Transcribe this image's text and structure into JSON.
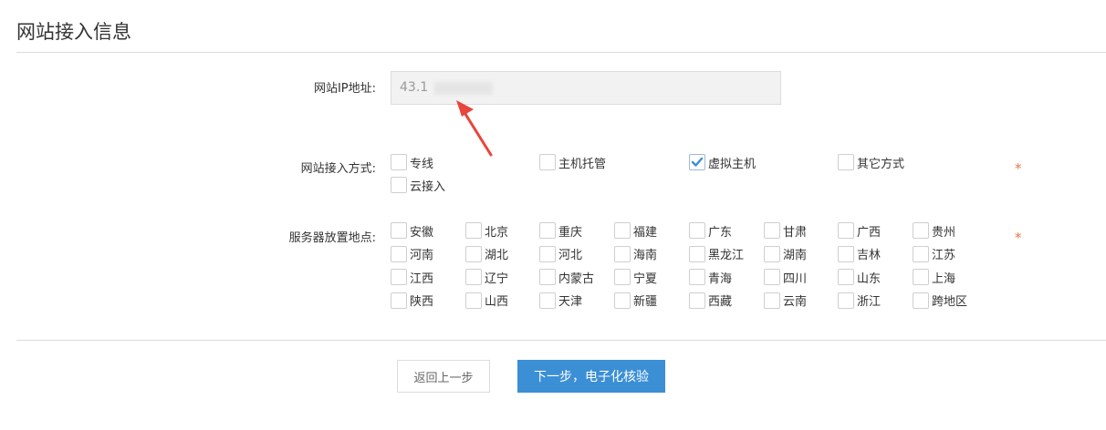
{
  "section_title": "网站接入信息",
  "ip_field": {
    "label": "网站IP地址:",
    "value": "43.1"
  },
  "access_method": {
    "label": "网站接入方式:",
    "options": [
      {
        "label": "专线",
        "checked": false
      },
      {
        "label": "主机托管",
        "checked": false
      },
      {
        "label": "虚拟主机",
        "checked": true
      },
      {
        "label": "其它方式",
        "checked": false
      },
      {
        "label": "云接入",
        "checked": false
      }
    ],
    "required_mark": "*"
  },
  "server_location": {
    "label": "服务器放置地点:",
    "options": [
      {
        "label": "安徽",
        "checked": false
      },
      {
        "label": "北京",
        "checked": false
      },
      {
        "label": "重庆",
        "checked": false
      },
      {
        "label": "福建",
        "checked": false
      },
      {
        "label": "广东",
        "checked": false
      },
      {
        "label": "甘肃",
        "checked": false
      },
      {
        "label": "广西",
        "checked": false
      },
      {
        "label": "贵州",
        "checked": false
      },
      {
        "label": "河南",
        "checked": false
      },
      {
        "label": "湖北",
        "checked": false
      },
      {
        "label": "河北",
        "checked": false
      },
      {
        "label": "海南",
        "checked": false
      },
      {
        "label": "黑龙江",
        "checked": false
      },
      {
        "label": "湖南",
        "checked": false
      },
      {
        "label": "吉林",
        "checked": false
      },
      {
        "label": "江苏",
        "checked": false
      },
      {
        "label": "江西",
        "checked": false
      },
      {
        "label": "辽宁",
        "checked": false
      },
      {
        "label": "内蒙古",
        "checked": false
      },
      {
        "label": "宁夏",
        "checked": false
      },
      {
        "label": "青海",
        "checked": false
      },
      {
        "label": "四川",
        "checked": false
      },
      {
        "label": "山东",
        "checked": false
      },
      {
        "label": "上海",
        "checked": false
      },
      {
        "label": "陕西",
        "checked": false
      },
      {
        "label": "山西",
        "checked": false
      },
      {
        "label": "天津",
        "checked": false
      },
      {
        "label": "新疆",
        "checked": false
      },
      {
        "label": "西藏",
        "checked": false
      },
      {
        "label": "云南",
        "checked": false
      },
      {
        "label": "浙江",
        "checked": false
      },
      {
        "label": "跨地区",
        "checked": false
      }
    ],
    "required_mark": "*"
  },
  "buttons": {
    "back_label": "返回上一步",
    "next_label": "下一步，电子化核验"
  },
  "colors": {
    "primary": "#3b8fd5",
    "required": "#e07a4a",
    "annotation_arrow": "#e8453c",
    "check": "#3b8fd5"
  },
  "icons": {
    "check": "check-icon",
    "annotation": "red-arrow-icon"
  }
}
